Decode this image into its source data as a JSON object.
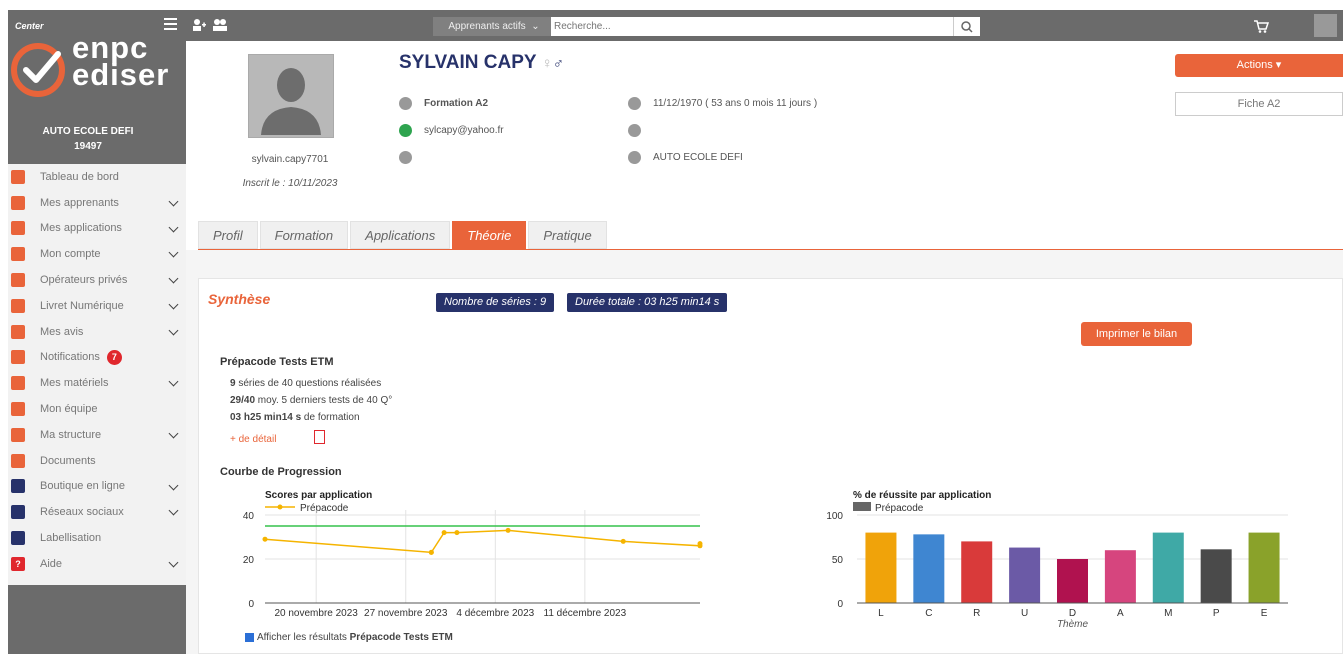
{
  "sidebar": {
    "brand_caption": "Center",
    "logo_line1": "enpc",
    "logo_line2": "ediser",
    "school_name": "AUTO ECOLE DEFI",
    "school_code": "19497",
    "items": [
      {
        "label": "Tableau de bord",
        "icon": "dashboard-icon",
        "chevron": false
      },
      {
        "label": "Mes apprenants",
        "icon": "users-icon",
        "chevron": true
      },
      {
        "label": "Mes applications",
        "icon": "apps-icon",
        "chevron": true
      },
      {
        "label": "Mon compte",
        "icon": "account-icon",
        "chevron": true
      },
      {
        "label": "Opérateurs privés",
        "icon": "operators-icon",
        "chevron": true
      },
      {
        "label": "Livret Numérique",
        "icon": "booklet-icon",
        "chevron": true
      },
      {
        "label": "Mes avis",
        "icon": "reviews-icon",
        "chevron": true
      },
      {
        "label": "Notifications",
        "icon": "bell-icon",
        "chevron": false,
        "badge": "7"
      },
      {
        "label": "Mes matériels",
        "icon": "equipment-icon",
        "chevron": true
      },
      {
        "label": "Mon équipe",
        "icon": "team-icon",
        "chevron": false
      },
      {
        "label": "Ma structure",
        "icon": "building-icon",
        "chevron": true
      },
      {
        "label": "Documents",
        "icon": "folder-icon",
        "chevron": false
      },
      {
        "label": "Boutique en ligne",
        "icon": "cart-icon",
        "chevron": true
      },
      {
        "label": "Réseaux sociaux",
        "icon": "thumbs-up-icon",
        "chevron": true
      },
      {
        "label": "Labellisation",
        "icon": "star-icon",
        "chevron": false
      },
      {
        "label": "Aide",
        "icon": "help-icon",
        "chevron": true
      }
    ]
  },
  "topbar": {
    "filter_value": "Apprenants actifs",
    "search_placeholder": "Recherche..."
  },
  "profile": {
    "name": "SYLVAIN CAPY",
    "username": "sylvain.capy7701",
    "registered": "Inscrit le : 10/11/2023",
    "formation": "Formation A2",
    "email": "sylcapy@yahoo.fr",
    "birth": "11/12/1970 ( 53 ans 0 mois 11 jours )",
    "school": "AUTO ECOLE DEFI"
  },
  "actions": {
    "label": "Actions ▾",
    "fiche": "Fiche A2"
  },
  "tabs": [
    "Profil",
    "Formation",
    "Applications",
    "Théorie",
    "Pratique"
  ],
  "active_tab": "Théorie",
  "synthese": {
    "title": "Synthèse",
    "series_pill": "Nombre de séries : 9",
    "duration_pill": "Durée totale : 03 h25 min14 s",
    "print_button": "Imprimer le bilan",
    "section_title": "Prépacode Tests ETM",
    "stat1_strong": "9",
    "stat1_text": " séries de 40 questions réalisées",
    "stat2_strong": "29/40",
    "stat2_text": " moy. 5 derniers tests de 40 Q°",
    "stat3_strong": "03 h25 min14 s",
    "stat3_text": " de formation",
    "detail_link": "+ de détail",
    "progress_title": "Courbe de Progression",
    "checkbox_prefix": "Afficher les résultats ",
    "checkbox_bold": "Prépacode Tests ETM"
  },
  "colors": {
    "accent": "#e9643a",
    "navy": "#27326a",
    "sidebar_gray": "#6b6b6b"
  },
  "chart_data": [
    {
      "type": "line",
      "title": "Scores par application",
      "ylim": [
        0,
        40
      ],
      "yticks": [
        0,
        20,
        40
      ],
      "xtick_labels": [
        "20 novembre 2023",
        "27 novembre 2023",
        "4 décembre 2023",
        "11 décembre 2023"
      ],
      "xtick_dates": [
        "2023-11-20",
        "2023-11-27",
        "2023-12-04",
        "2023-12-11"
      ],
      "xlim": [
        "2023-11-16",
        "2023-12-20"
      ],
      "threshold": 35,
      "series": [
        {
          "name": "Prépacode",
          "color": "#f5b400",
          "points": [
            [
              "2023-11-16",
              29
            ],
            [
              "2023-11-29",
              23
            ],
            [
              "2023-11-29",
              23
            ],
            [
              "2023-11-30",
              32
            ],
            [
              "2023-12-01",
              32
            ],
            [
              "2023-12-05",
              33
            ],
            [
              "2023-12-14",
              28
            ],
            [
              "2023-12-20",
              26
            ],
            [
              "2023-12-20",
              27
            ]
          ]
        }
      ]
    },
    {
      "type": "bar",
      "title": "% de réussite par application",
      "legend": "Prépacode",
      "xlabel": "Thème",
      "ylim": [
        0,
        100
      ],
      "yticks": [
        0,
        50,
        100
      ],
      "categories": [
        "L",
        "C",
        "R",
        "U",
        "D",
        "A",
        "M",
        "P",
        "E"
      ],
      "values": [
        80,
        78,
        70,
        63,
        50,
        60,
        80,
        61,
        80
      ],
      "colors": [
        "#f0a30a",
        "#3f86d1",
        "#d93a3a",
        "#6b5aa6",
        "#b0124f",
        "#d6457e",
        "#3fa9a6",
        "#4a4a4a",
        "#8aa22a"
      ]
    }
  ]
}
